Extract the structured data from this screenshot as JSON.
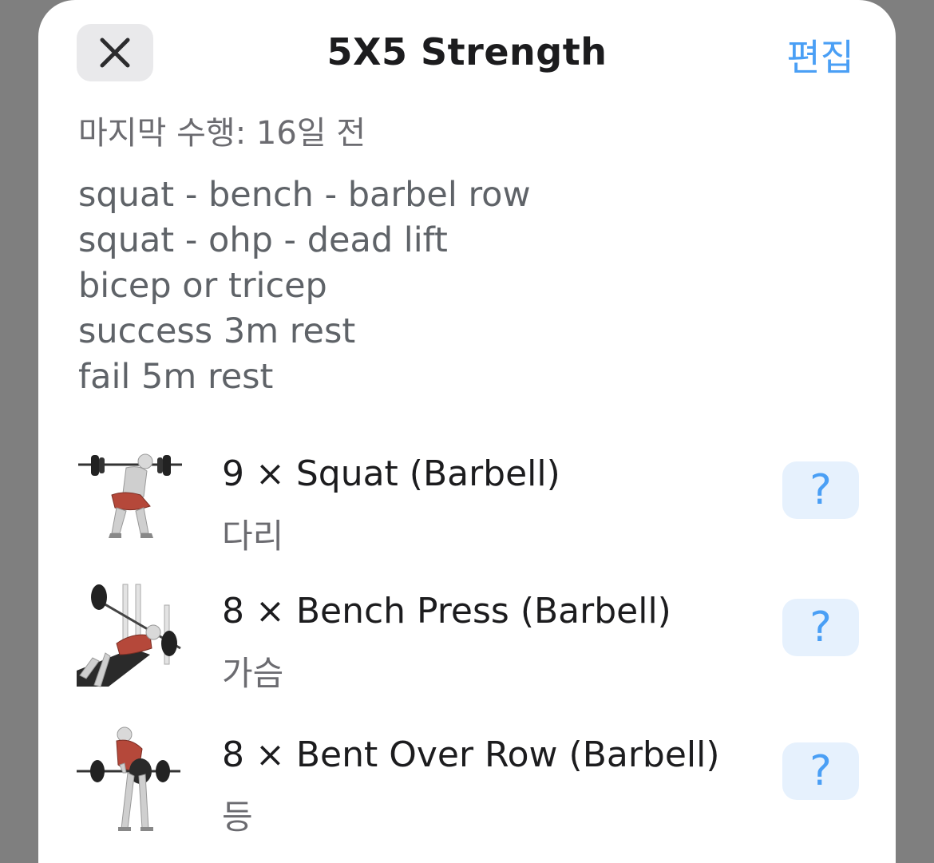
{
  "header": {
    "title": "5X5 Strength",
    "edit_label": "편집",
    "close_icon": "close-icon"
  },
  "last_done": "마지막 수행: 16일 전",
  "notes": [
    "squat - bench - barbel row",
    "squat - ohp - dead lift",
    "bicep or tricep",
    "success 3m rest",
    "fail 5m rest"
  ],
  "exercises": [
    {
      "name": "9 × Squat (Barbell)",
      "category": "다리",
      "help": "?",
      "image": "squat-illustration"
    },
    {
      "name": "8 × Bench Press (Barbell)",
      "category": "가슴",
      "help": "?",
      "image": "bench-press-illustration"
    },
    {
      "name": "8 × Bent Over Row (Barbell)",
      "category": "등",
      "help": "?",
      "image": "bent-over-row-illustration"
    }
  ],
  "colors": {
    "accent": "#4a9ff5",
    "backdrop": "#7f7f7f",
    "sheet": "#ffffff",
    "muscle": "#b5483a"
  }
}
